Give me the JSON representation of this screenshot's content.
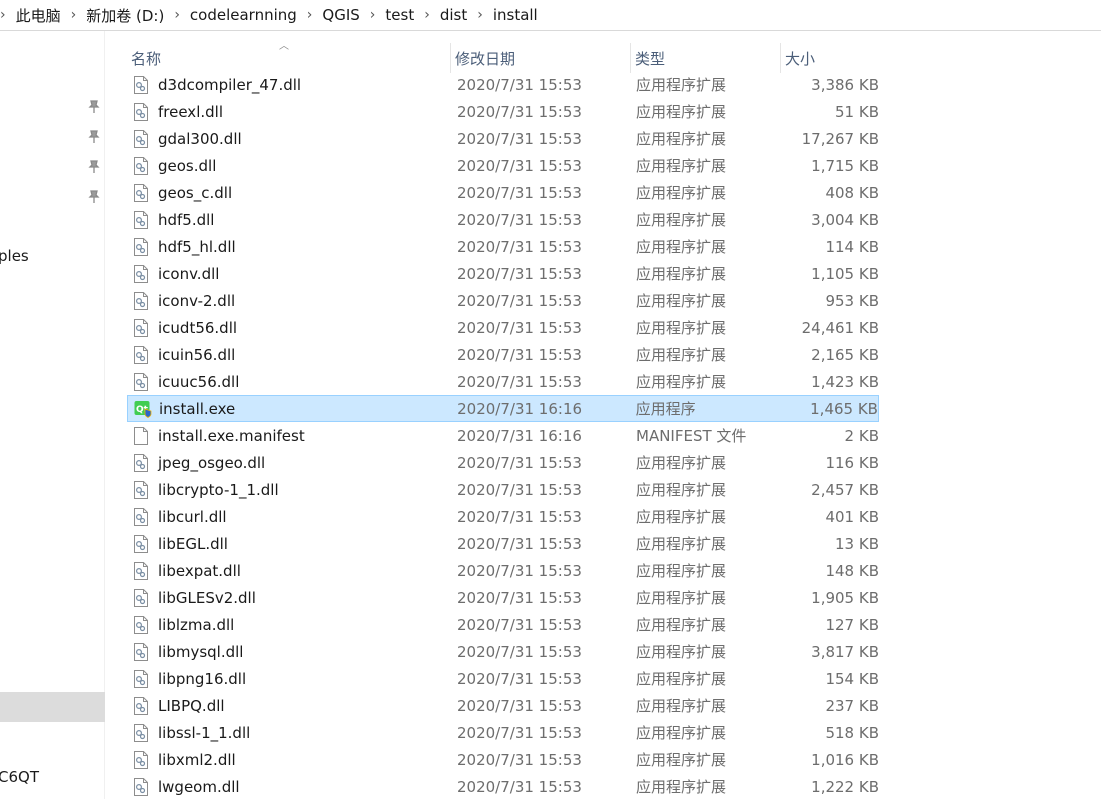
{
  "breadcrumb": [
    "此电脑",
    "新加卷 (D:)",
    "codelearnning",
    "QGIS",
    "test",
    "dist",
    "install"
  ],
  "sidebar": {
    "label_ples": "ples",
    "label_c6qt": "C6QT"
  },
  "columns": {
    "name": "名称",
    "date": "修改日期",
    "type": "类型",
    "size": "大小"
  },
  "files": [
    {
      "name": "d3dcompiler_47.dll",
      "date": "2020/7/31 15:53",
      "type": "应用程序扩展",
      "size": "3,386 KB",
      "icon": "dll-file-icon"
    },
    {
      "name": "freexl.dll",
      "date": "2020/7/31 15:53",
      "type": "应用程序扩展",
      "size": "51 KB",
      "icon": "dll-file-icon"
    },
    {
      "name": "gdal300.dll",
      "date": "2020/7/31 15:53",
      "type": "应用程序扩展",
      "size": "17,267 KB",
      "icon": "dll-file-icon"
    },
    {
      "name": "geos.dll",
      "date": "2020/7/31 15:53",
      "type": "应用程序扩展",
      "size": "1,715 KB",
      "icon": "dll-file-icon"
    },
    {
      "name": "geos_c.dll",
      "date": "2020/7/31 15:53",
      "type": "应用程序扩展",
      "size": "408 KB",
      "icon": "dll-file-icon"
    },
    {
      "name": "hdf5.dll",
      "date": "2020/7/31 15:53",
      "type": "应用程序扩展",
      "size": "3,004 KB",
      "icon": "dll-file-icon"
    },
    {
      "name": "hdf5_hl.dll",
      "date": "2020/7/31 15:53",
      "type": "应用程序扩展",
      "size": "114 KB",
      "icon": "dll-file-icon"
    },
    {
      "name": "iconv.dll",
      "date": "2020/7/31 15:53",
      "type": "应用程序扩展",
      "size": "1,105 KB",
      "icon": "dll-file-icon"
    },
    {
      "name": "iconv-2.dll",
      "date": "2020/7/31 15:53",
      "type": "应用程序扩展",
      "size": "953 KB",
      "icon": "dll-file-icon"
    },
    {
      "name": "icudt56.dll",
      "date": "2020/7/31 15:53",
      "type": "应用程序扩展",
      "size": "24,461 KB",
      "icon": "dll-file-icon"
    },
    {
      "name": "icuin56.dll",
      "date": "2020/7/31 15:53",
      "type": "应用程序扩展",
      "size": "2,165 KB",
      "icon": "dll-file-icon"
    },
    {
      "name": "icuuc56.dll",
      "date": "2020/7/31 15:53",
      "type": "应用程序扩展",
      "size": "1,423 KB",
      "icon": "dll-file-icon"
    },
    {
      "name": "install.exe",
      "date": "2020/7/31 16:16",
      "type": "应用程序",
      "size": "1,465 KB",
      "icon": "qt-app-icon",
      "selected": true
    },
    {
      "name": "install.exe.manifest",
      "date": "2020/7/31 16:16",
      "type": "MANIFEST 文件",
      "size": "2 KB",
      "icon": "blank-file-icon"
    },
    {
      "name": "jpeg_osgeo.dll",
      "date": "2020/7/31 15:53",
      "type": "应用程序扩展",
      "size": "116 KB",
      "icon": "dll-file-icon"
    },
    {
      "name": "libcrypto-1_1.dll",
      "date": "2020/7/31 15:53",
      "type": "应用程序扩展",
      "size": "2,457 KB",
      "icon": "dll-file-icon"
    },
    {
      "name": "libcurl.dll",
      "date": "2020/7/31 15:53",
      "type": "应用程序扩展",
      "size": "401 KB",
      "icon": "dll-file-icon"
    },
    {
      "name": "libEGL.dll",
      "date": "2020/7/31 15:53",
      "type": "应用程序扩展",
      "size": "13 KB",
      "icon": "dll-file-icon"
    },
    {
      "name": "libexpat.dll",
      "date": "2020/7/31 15:53",
      "type": "应用程序扩展",
      "size": "148 KB",
      "icon": "dll-file-icon"
    },
    {
      "name": "libGLESv2.dll",
      "date": "2020/7/31 15:53",
      "type": "应用程序扩展",
      "size": "1,905 KB",
      "icon": "dll-file-icon"
    },
    {
      "name": "liblzma.dll",
      "date": "2020/7/31 15:53",
      "type": "应用程序扩展",
      "size": "127 KB",
      "icon": "dll-file-icon"
    },
    {
      "name": "libmysql.dll",
      "date": "2020/7/31 15:53",
      "type": "应用程序扩展",
      "size": "3,817 KB",
      "icon": "dll-file-icon"
    },
    {
      "name": "libpng16.dll",
      "date": "2020/7/31 15:53",
      "type": "应用程序扩展",
      "size": "154 KB",
      "icon": "dll-file-icon"
    },
    {
      "name": "LIBPQ.dll",
      "date": "2020/7/31 15:53",
      "type": "应用程序扩展",
      "size": "237 KB",
      "icon": "dll-file-icon"
    },
    {
      "name": "libssl-1_1.dll",
      "date": "2020/7/31 15:53",
      "type": "应用程序扩展",
      "size": "518 KB",
      "icon": "dll-file-icon"
    },
    {
      "name": "libxml2.dll",
      "date": "2020/7/31 15:53",
      "type": "应用程序扩展",
      "size": "1,016 KB",
      "icon": "dll-file-icon"
    },
    {
      "name": "lwgeom.dll",
      "date": "2020/7/31 15:53",
      "type": "应用程序扩展",
      "size": "1,222 KB",
      "icon": "dll-file-icon"
    }
  ]
}
